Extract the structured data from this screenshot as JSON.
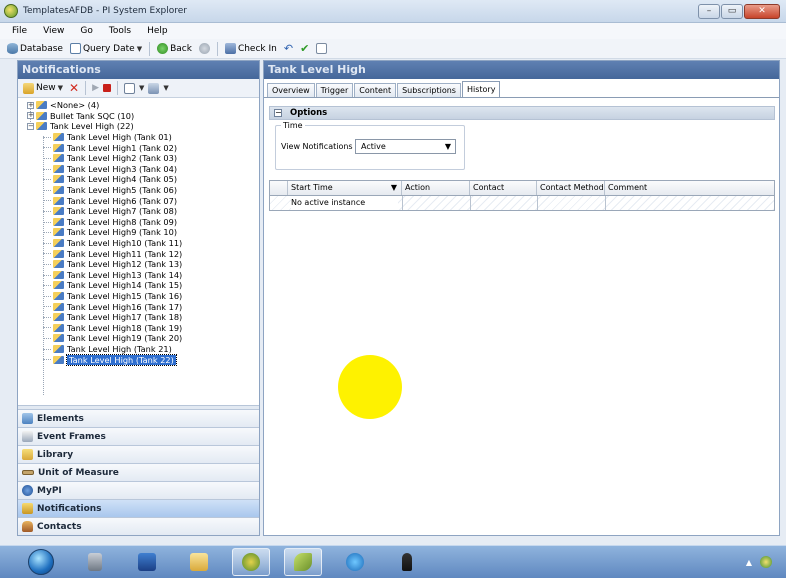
{
  "window": {
    "title": "TemplatesAFDB - PI System Explorer",
    "minimize": "–",
    "maximize": "▭",
    "close": "✕"
  },
  "menu": [
    "File",
    "View",
    "Go",
    "Tools",
    "Help"
  ],
  "toolbar": {
    "database": "Database",
    "query_date": "Query Date",
    "back": "Back",
    "check_in": "Check In"
  },
  "left": {
    "header": "Notifications",
    "new_label": "New",
    "tree": [
      {
        "label": "<None> (4)",
        "level": 0,
        "expander": "+"
      },
      {
        "label": "Bullet Tank SQC (10)",
        "level": 0,
        "expander": "+"
      },
      {
        "label": "Tank Level High (22)",
        "level": 0,
        "expander": "−"
      },
      {
        "label": "Tank Level High (Tank 01)",
        "level": 1
      },
      {
        "label": "Tank Level High1 (Tank 02)",
        "level": 1
      },
      {
        "label": "Tank Level High2 (Tank 03)",
        "level": 1
      },
      {
        "label": "Tank Level High3 (Tank 04)",
        "level": 1
      },
      {
        "label": "Tank Level High4 (Tank 05)",
        "level": 1
      },
      {
        "label": "Tank Level High5 (Tank 06)",
        "level": 1
      },
      {
        "label": "Tank Level High6 (Tank 07)",
        "level": 1
      },
      {
        "label": "Tank Level High7 (Tank 08)",
        "level": 1
      },
      {
        "label": "Tank Level High8 (Tank 09)",
        "level": 1
      },
      {
        "label": "Tank Level High9 (Tank 10)",
        "level": 1
      },
      {
        "label": "Tank Level High10 (Tank 11)",
        "level": 1
      },
      {
        "label": "Tank Level High11 (Tank 12)",
        "level": 1
      },
      {
        "label": "Tank Level High12 (Tank 13)",
        "level": 1
      },
      {
        "label": "Tank Level High13 (Tank 14)",
        "level": 1
      },
      {
        "label": "Tank Level High14 (Tank 15)",
        "level": 1
      },
      {
        "label": "Tank Level High15 (Tank 16)",
        "level": 1
      },
      {
        "label": "Tank Level High16 (Tank 17)",
        "level": 1
      },
      {
        "label": "Tank Level High17 (Tank 18)",
        "level": 1
      },
      {
        "label": "Tank Level High18 (Tank 19)",
        "level": 1
      },
      {
        "label": "Tank Level High19 (Tank 20)",
        "level": 1
      },
      {
        "label": "Tank Level High (Tank 21)",
        "level": 1
      },
      {
        "label": "Tank Level High (Tank 22)",
        "level": 1,
        "selected": true
      }
    ],
    "nav": [
      {
        "label": "Elements",
        "icon": "elements-icon"
      },
      {
        "label": "Event Frames",
        "icon": "event-frames-icon"
      },
      {
        "label": "Library",
        "icon": "library-icon"
      },
      {
        "label": "Unit of Measure",
        "icon": "unit-of-measure-icon"
      },
      {
        "label": "MyPI",
        "icon": "mypi-icon"
      },
      {
        "label": "Notifications",
        "icon": "notifications-icon",
        "active": true
      },
      {
        "label": "Contacts",
        "icon": "contacts-icon"
      }
    ]
  },
  "right": {
    "header": "Tank Level High",
    "tabs": [
      {
        "label": "Overview"
      },
      {
        "label": "Trigger"
      },
      {
        "label": "Content"
      },
      {
        "label": "Subscriptions"
      },
      {
        "label": "History",
        "active": true
      }
    ],
    "options": {
      "title": "Options",
      "time_group": "Time",
      "view_notifications_label": "View Notifications",
      "view_notifications_value": "Active"
    },
    "grid": {
      "columns": [
        "Start Time",
        "Action",
        "Contact",
        "Contact Method",
        "Comment"
      ],
      "empty_message": "No active instance"
    }
  },
  "colors": {
    "header_blue": "#4f71a6",
    "selection_blue": "#2f6fd0",
    "marker_yellow": "#fef200"
  }
}
